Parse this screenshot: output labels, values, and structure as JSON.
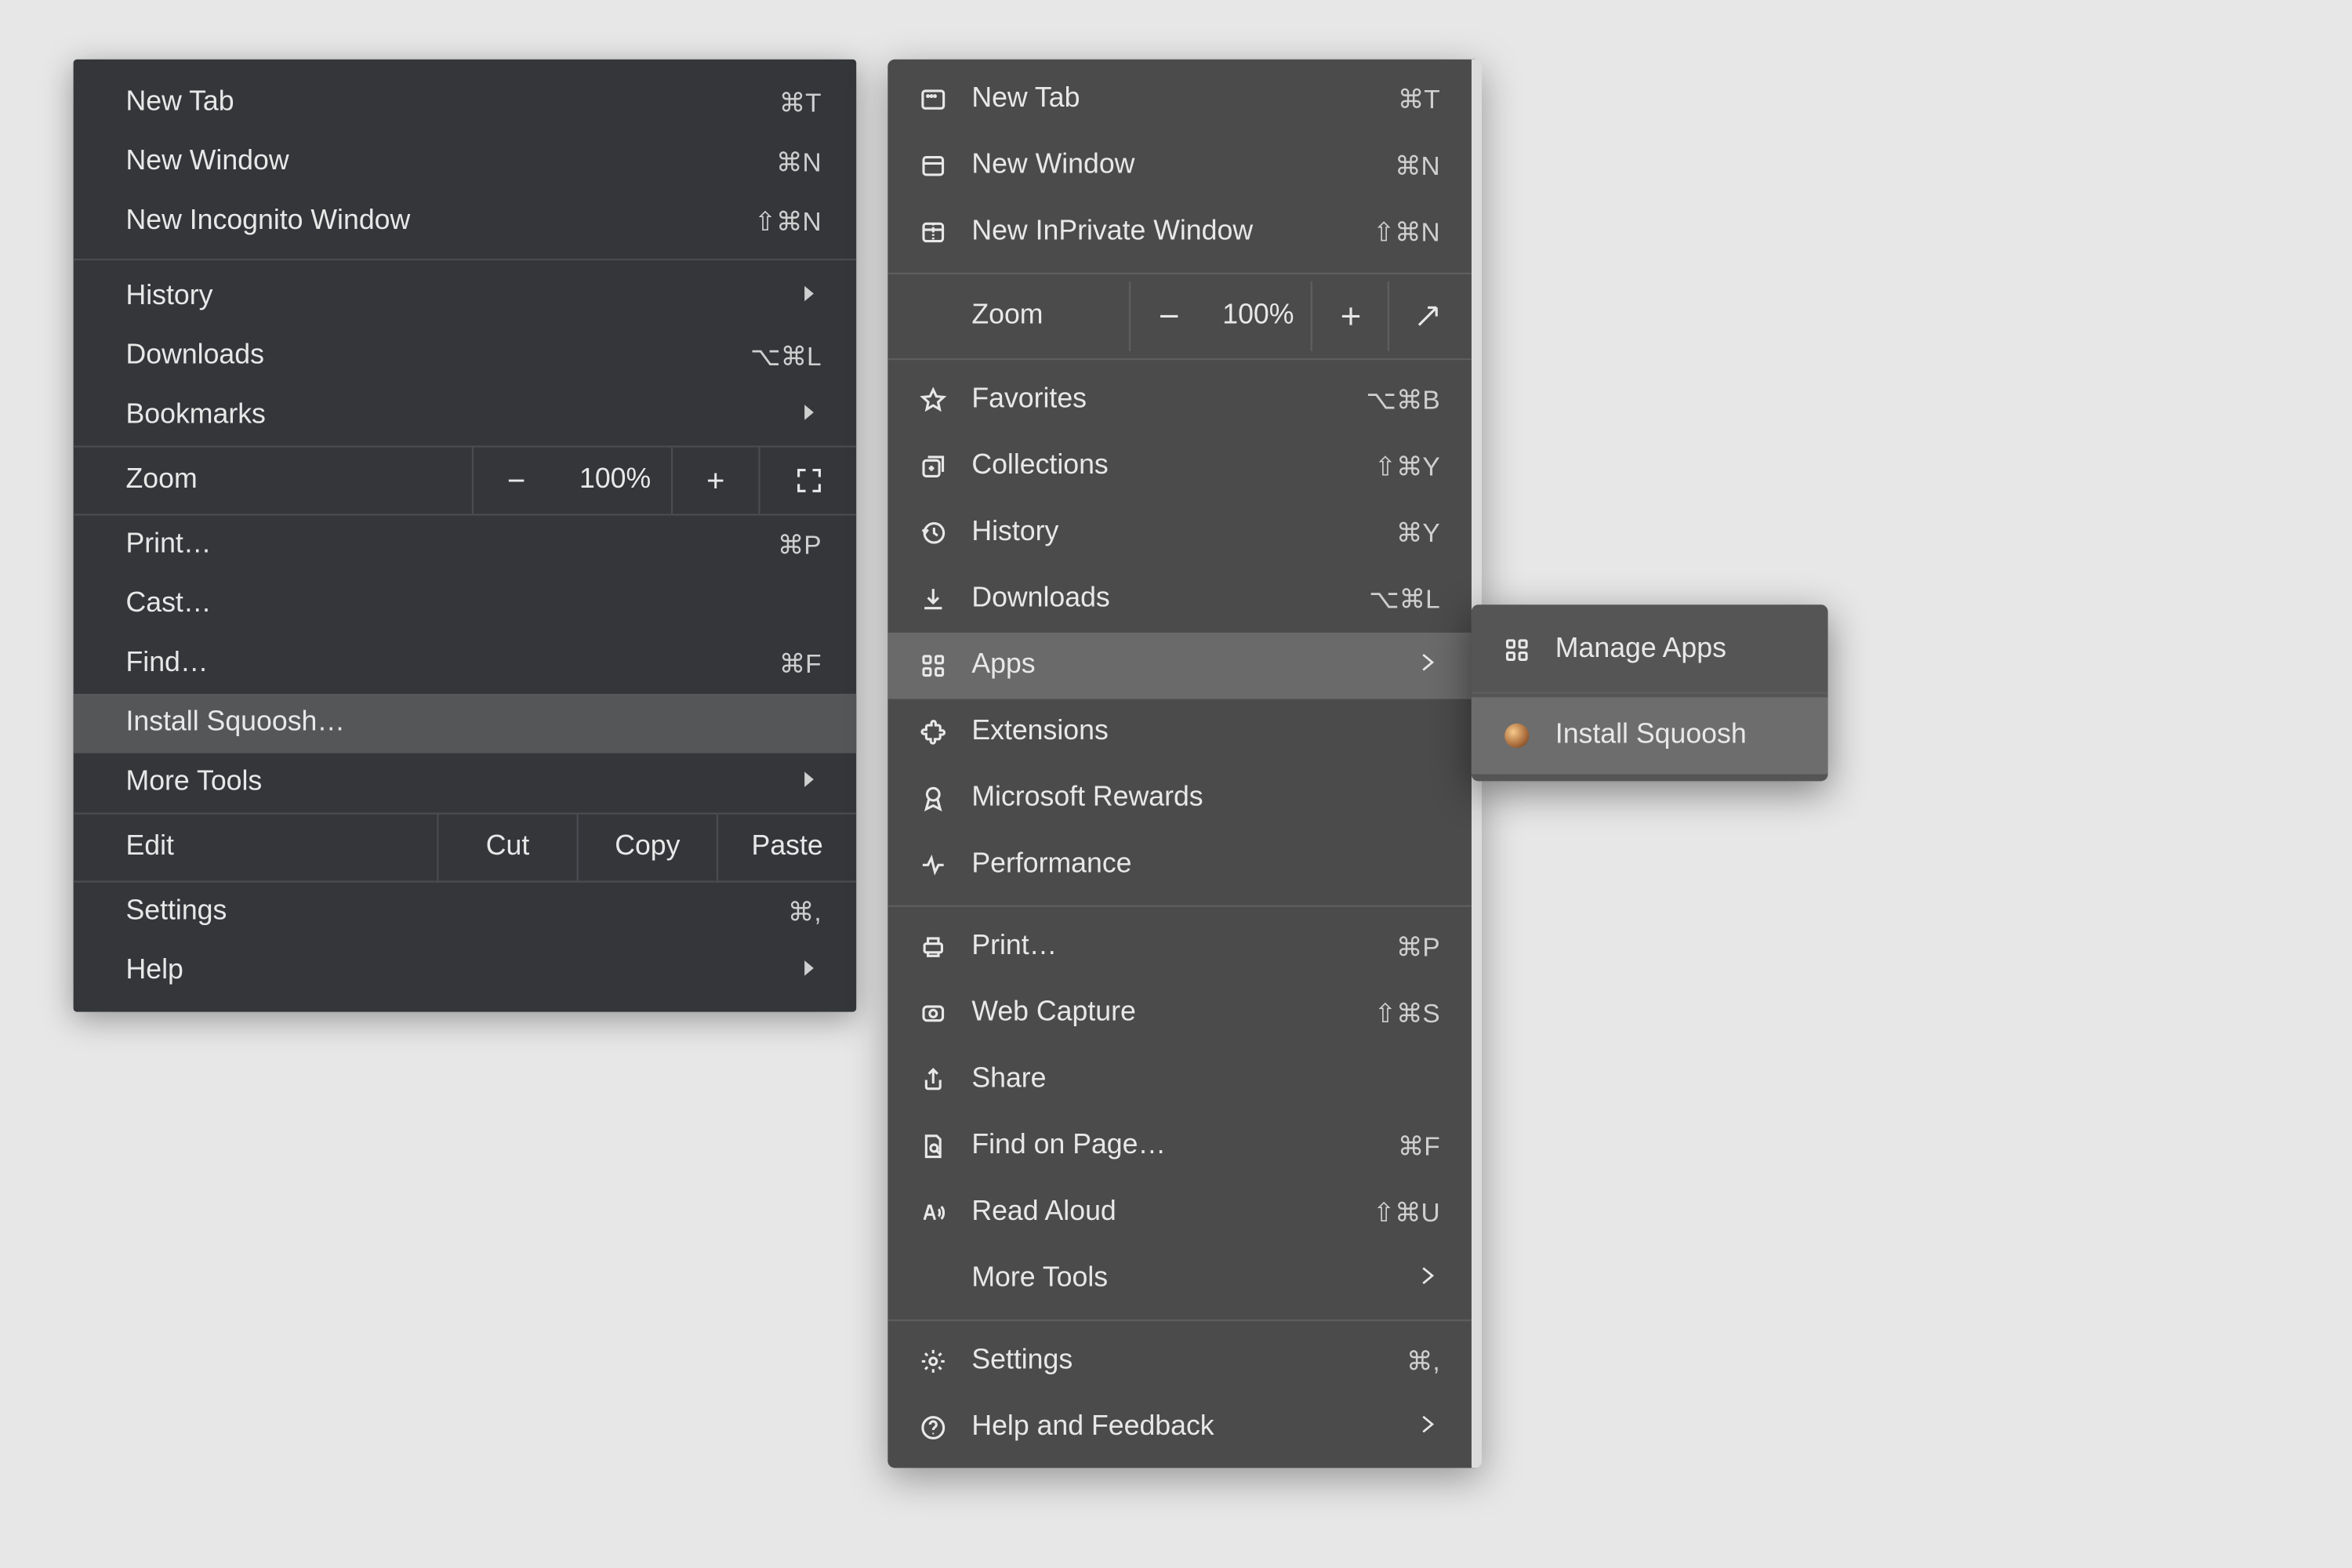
{
  "chrome_menu": {
    "new_tab": {
      "label": "New Tab",
      "shortcut": "⌘T"
    },
    "new_window": {
      "label": "New Window",
      "shortcut": "⌘N"
    },
    "new_incog": {
      "label": "New Incognito Window",
      "shortcut": "⇧⌘N"
    },
    "history": {
      "label": "History"
    },
    "downloads": {
      "label": "Downloads",
      "shortcut": "⌥⌘L"
    },
    "bookmarks": {
      "label": "Bookmarks"
    },
    "zoom": {
      "label": "Zoom",
      "value": "100%",
      "minus": "−",
      "plus": "+"
    },
    "print": {
      "label": "Print…",
      "shortcut": "⌘P"
    },
    "cast": {
      "label": "Cast…"
    },
    "find": {
      "label": "Find…",
      "shortcut": "⌘F"
    },
    "install": {
      "label": "Install Squoosh…"
    },
    "more_tools": {
      "label": "More Tools"
    },
    "edit": {
      "label": "Edit",
      "cut": "Cut",
      "copy": "Copy",
      "paste": "Paste"
    },
    "settings": {
      "label": "Settings",
      "shortcut": "⌘,"
    },
    "help": {
      "label": "Help"
    }
  },
  "edge_menu": {
    "new_tab": {
      "label": "New Tab",
      "shortcut": "⌘T"
    },
    "new_window": {
      "label": "New Window",
      "shortcut": "⌘N"
    },
    "new_inpriv": {
      "label": "New InPrivate Window",
      "shortcut": "⇧⌘N"
    },
    "zoom": {
      "label": "Zoom",
      "value": "100%"
    },
    "favorites": {
      "label": "Favorites",
      "shortcut": "⌥⌘B"
    },
    "collections": {
      "label": "Collections",
      "shortcut": "⇧⌘Y"
    },
    "history": {
      "label": "History",
      "shortcut": "⌘Y"
    },
    "downloads": {
      "label": "Downloads",
      "shortcut": "⌥⌘L"
    },
    "apps": {
      "label": "Apps"
    },
    "extensions": {
      "label": "Extensions"
    },
    "ms_rewards": {
      "label": "Microsoft Rewards"
    },
    "performance": {
      "label": "Performance"
    },
    "print": {
      "label": "Print…",
      "shortcut": "⌘P"
    },
    "web_capture": {
      "label": "Web Capture",
      "shortcut": "⇧⌘S"
    },
    "share": {
      "label": "Share"
    },
    "find": {
      "label": "Find on Page…",
      "shortcut": "⌘F"
    },
    "read_aloud": {
      "label": "Read Aloud",
      "shortcut": "⇧⌘U"
    },
    "more_tools": {
      "label": "More Tools"
    },
    "settings": {
      "label": "Settings",
      "shortcut": "⌘,"
    },
    "help": {
      "label": "Help and Feedback"
    }
  },
  "edge_submenu": {
    "manage": {
      "label": "Manage Apps"
    },
    "install": {
      "label": "Install Squoosh"
    }
  }
}
